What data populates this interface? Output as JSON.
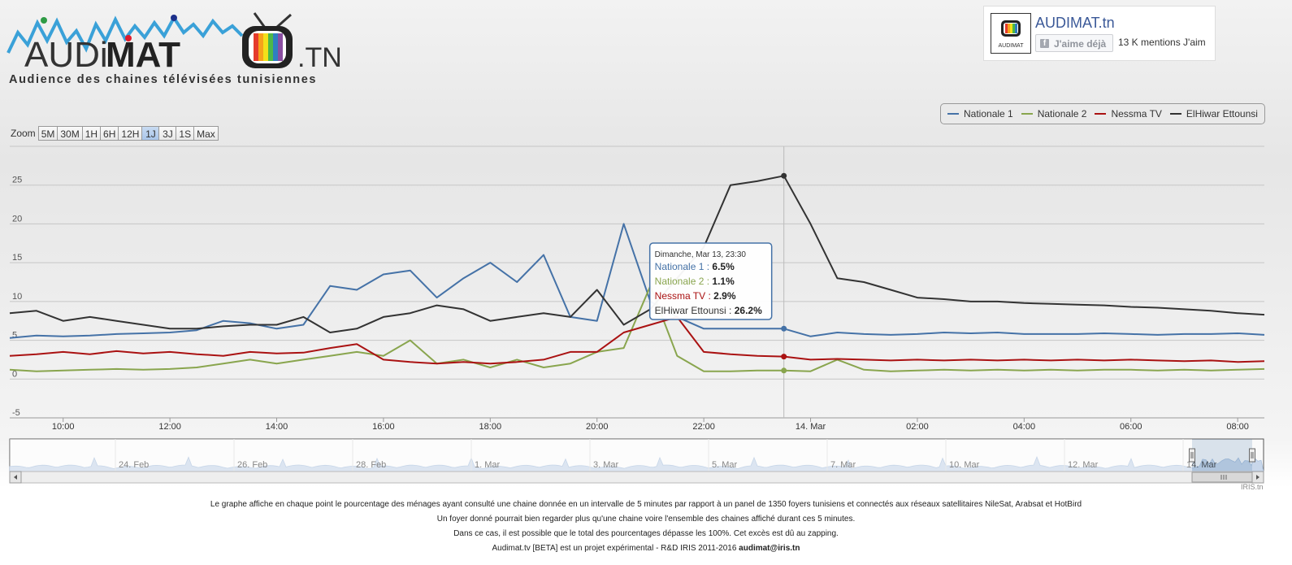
{
  "logo": {
    "text_audi": "AUDi",
    "text_mat": "MAT",
    "text_tn": ".TN",
    "tagline": "Audience des chaines télévisées tunisiennes"
  },
  "facebook": {
    "page_name": "AUDIMAT.tn",
    "like_button": "J'aime déjà",
    "like_count": "13 K mentions J'aim",
    "thumb_label": "AUDIMAT",
    "icon": "facebook-icon"
  },
  "zoom": {
    "label": "Zoom",
    "buttons": [
      "5M",
      "30M",
      "1H",
      "6H",
      "12H",
      "1J",
      "3J",
      "1S",
      "Max"
    ],
    "active": "1J"
  },
  "colors": {
    "nationale1": "#4572a7",
    "nationale2": "#89a54e",
    "nessma": "#aa1212",
    "elhiwar": "#333333",
    "navigator_fill": "#c9d7ea"
  },
  "chart_data": {
    "type": "line",
    "title": "",
    "xlabel": "",
    "ylabel": "",
    "unit": "%",
    "ylim": [
      -5,
      30
    ],
    "yticks": [
      -5,
      0,
      5,
      10,
      15,
      20,
      25
    ],
    "xlim": [
      "2016-03-13 09:00",
      "2016-03-14 08:30"
    ],
    "xticks": [
      "10:00",
      "12:00",
      "14:00",
      "16:00",
      "18:00",
      "20:00",
      "22:00",
      "14. Mar",
      "02:00",
      "04:00",
      "06:00",
      "08:00"
    ],
    "grid": true,
    "legend_position": "top-right",
    "x": [
      "09:00",
      "09:30",
      "10:00",
      "10:30",
      "11:00",
      "11:30",
      "12:00",
      "12:30",
      "13:00",
      "13:30",
      "14:00",
      "14:30",
      "15:00",
      "15:30",
      "16:00",
      "16:30",
      "17:00",
      "17:30",
      "18:00",
      "18:30",
      "19:00",
      "19:30",
      "20:00",
      "20:30",
      "21:00",
      "21:30",
      "22:00",
      "22:30",
      "23:00",
      "23:30",
      "00:00",
      "00:30",
      "01:00",
      "01:30",
      "02:00",
      "02:30",
      "03:00",
      "03:30",
      "04:00",
      "04:30",
      "05:00",
      "05:30",
      "06:00",
      "06:30",
      "07:00",
      "07:30",
      "08:00",
      "08:30"
    ],
    "series": [
      {
        "name": "Nationale 1",
        "values": [
          5.3,
          5.6,
          5.5,
          5.6,
          5.8,
          5.9,
          6.0,
          6.3,
          7.5,
          7.2,
          6.5,
          7.0,
          12.0,
          11.5,
          13.5,
          14.0,
          10.5,
          13.0,
          15.0,
          12.5,
          16.0,
          8.0,
          7.5,
          20.0,
          10.0,
          8.0,
          6.5,
          6.5,
          6.5,
          6.5,
          5.5,
          6.0,
          5.8,
          5.7,
          5.8,
          6.0,
          5.9,
          6.0,
          5.8,
          5.8,
          5.8,
          5.9,
          5.8,
          5.7,
          5.8,
          5.8,
          5.9,
          5.7
        ]
      },
      {
        "name": "Nationale 2",
        "values": [
          1.2,
          1.0,
          1.1,
          1.2,
          1.3,
          1.2,
          1.3,
          1.5,
          2.0,
          2.5,
          2.0,
          2.5,
          3.0,
          3.5,
          3.0,
          5.0,
          2.0,
          2.5,
          1.5,
          2.5,
          1.5,
          2.0,
          3.5,
          4.0,
          12.0,
          3.0,
          1.0,
          1.0,
          1.1,
          1.1,
          1.0,
          2.5,
          1.2,
          1.0,
          1.1,
          1.2,
          1.1,
          1.2,
          1.1,
          1.2,
          1.1,
          1.2,
          1.2,
          1.1,
          1.2,
          1.1,
          1.2,
          1.3
        ]
      },
      {
        "name": "Nessma TV",
        "values": [
          3.0,
          3.2,
          3.5,
          3.2,
          3.6,
          3.3,
          3.5,
          3.2,
          3.0,
          3.5,
          3.3,
          3.4,
          4.0,
          4.5,
          2.5,
          2.2,
          2.0,
          2.2,
          2.0,
          2.2,
          2.5,
          3.5,
          3.5,
          6.0,
          7.0,
          8.0,
          3.5,
          3.2,
          3.0,
          2.9,
          2.5,
          2.6,
          2.5,
          2.4,
          2.5,
          2.4,
          2.5,
          2.4,
          2.5,
          2.4,
          2.5,
          2.4,
          2.5,
          2.4,
          2.3,
          2.4,
          2.2,
          2.3
        ]
      },
      {
        "name": "ElHiwar Ettounsi",
        "values": [
          8.5,
          8.8,
          7.5,
          8.0,
          7.5,
          7.0,
          6.5,
          6.5,
          6.8,
          7.0,
          7.0,
          8.0,
          6.0,
          6.5,
          8.0,
          8.5,
          9.5,
          9.0,
          7.5,
          8.0,
          8.5,
          8.0,
          11.5,
          7.0,
          9.0,
          13.0,
          17.0,
          25.0,
          25.5,
          26.2,
          20.0,
          13.0,
          12.5,
          11.5,
          10.5,
          10.3,
          10.0,
          10.0,
          9.8,
          9.7,
          9.6,
          9.5,
          9.3,
          9.2,
          9.0,
          8.8,
          8.5,
          8.3
        ]
      }
    ],
    "tooltip": {
      "header": "Dimanche, Mar 13, 23:30",
      "rows": [
        {
          "name": "Nationale 1",
          "value": "6.5%"
        },
        {
          "name": "Nationale 2",
          "value": "1.1%"
        },
        {
          "name": "Nessma TV",
          "value": "2.9%"
        },
        {
          "name": "ElHiwar Ettounsi",
          "value": "26.2%"
        }
      ],
      "x_index": 29
    },
    "navigator": {
      "labels": [
        "24. Feb",
        "26. Feb",
        "28. Feb",
        "1. Mar",
        "3. Mar",
        "5. Mar",
        "7. Mar",
        "10. Mar",
        "12. Mar",
        "14. Mar"
      ],
      "selected_range": [
        "2016-03-13 09:00",
        "2016-03-14 08:30"
      ]
    }
  },
  "credit": "IRIS.tn",
  "footer": {
    "line1": "Le graphe affiche en chaque point le pourcentage des ménages ayant consulté une chaine donnée en un intervalle de 5 minutes par rapport à un panel de 1350 foyers tunisiens et connectés aux réseaux satellitaires NileSat, Arabsat et HotBird",
    "line2": "Un foyer donné pourrait bien regarder plus qu'une chaine voire l'ensemble des chaines affiché durant ces 5 minutes.",
    "line3": "Dans ce cas, il est possible que le total des pourcentages dépasse les 100%. Cet excès est dû au zapping.",
    "line4": "Audimat.tv [BETA] est un projet expérimental - R&D IRIS 2011-2016",
    "email": "audimat@iris.tn"
  }
}
